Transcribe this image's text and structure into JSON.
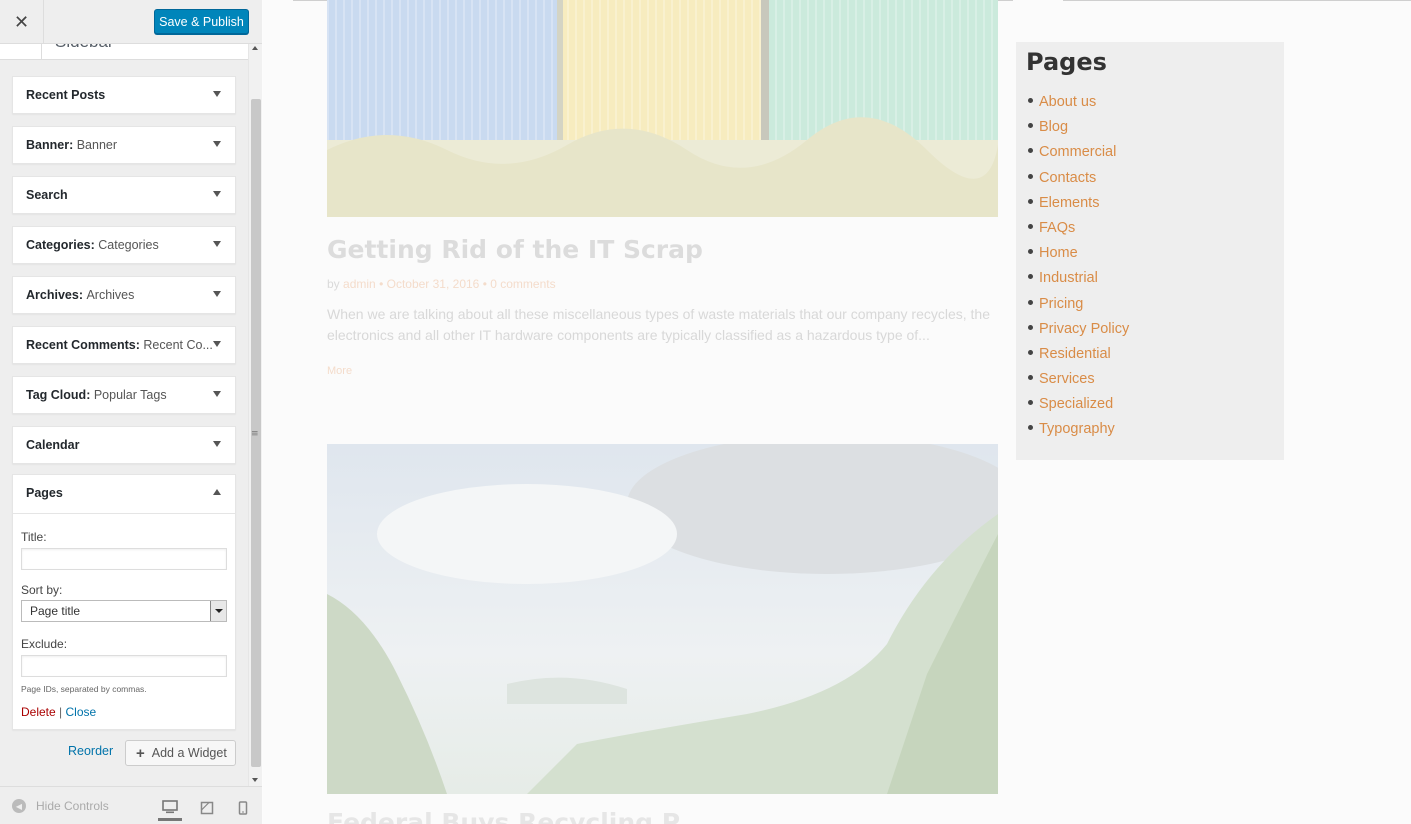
{
  "header": {
    "close_label": "✕",
    "save_label": "Save & Publish"
  },
  "section": {
    "title": "Sidebar"
  },
  "widgets": [
    {
      "title": "Recent Posts",
      "subtitle": ""
    },
    {
      "title": "Banner",
      "subtitle": "Banner"
    },
    {
      "title": "Search",
      "subtitle": ""
    },
    {
      "title": "Categories",
      "subtitle": "Categories"
    },
    {
      "title": "Archives",
      "subtitle": "Archives"
    },
    {
      "title": "Recent Comments",
      "subtitle": "Recent Co..."
    },
    {
      "title": "Tag Cloud",
      "subtitle": "Popular Tags"
    },
    {
      "title": "Calendar",
      "subtitle": ""
    },
    {
      "title": "Pages",
      "subtitle": ""
    }
  ],
  "pages_form": {
    "title_label": "Title:",
    "title_value": "",
    "sort_label": "Sort by:",
    "sort_value": "Page title",
    "exclude_label": "Exclude:",
    "exclude_value": "",
    "exclude_hint": "Page IDs, separated by commas.",
    "delete_label": "Delete",
    "separator": "|",
    "close_label": "Close"
  },
  "actions": {
    "reorder_label": "Reorder",
    "add_widget_label": "Add a Widget"
  },
  "footer": {
    "hide_controls_label": "Hide Controls",
    "active_device": "desktop"
  },
  "preview": {
    "post_title": "Getting Rid of the IT Scrap",
    "meta_by": "by",
    "meta_author": "admin",
    "meta_dot": "•",
    "meta_date": "October 31, 2016",
    "meta_comments": "0 comments",
    "excerpt": "When we are talking about all these miscellaneous types of waste materials that our company recycles, the electronics and all other IT hardware components are typically classified as a hazardous type of...",
    "more_label": "More",
    "post2_title": "Federal Buys Recycling P",
    "pages_heading": "Pages",
    "pages": [
      "About us",
      "Blog",
      "Commercial",
      "Contacts",
      "Elements",
      "FAQs",
      "Home",
      "Industrial",
      "Pricing",
      "Privacy Policy",
      "Residential",
      "Services",
      "Specialized",
      "Typography"
    ],
    "link_color": "#d98c47"
  },
  "colors": {
    "primary_button": "#0085ba",
    "link": "#0073aa",
    "delete": "#a00000"
  }
}
